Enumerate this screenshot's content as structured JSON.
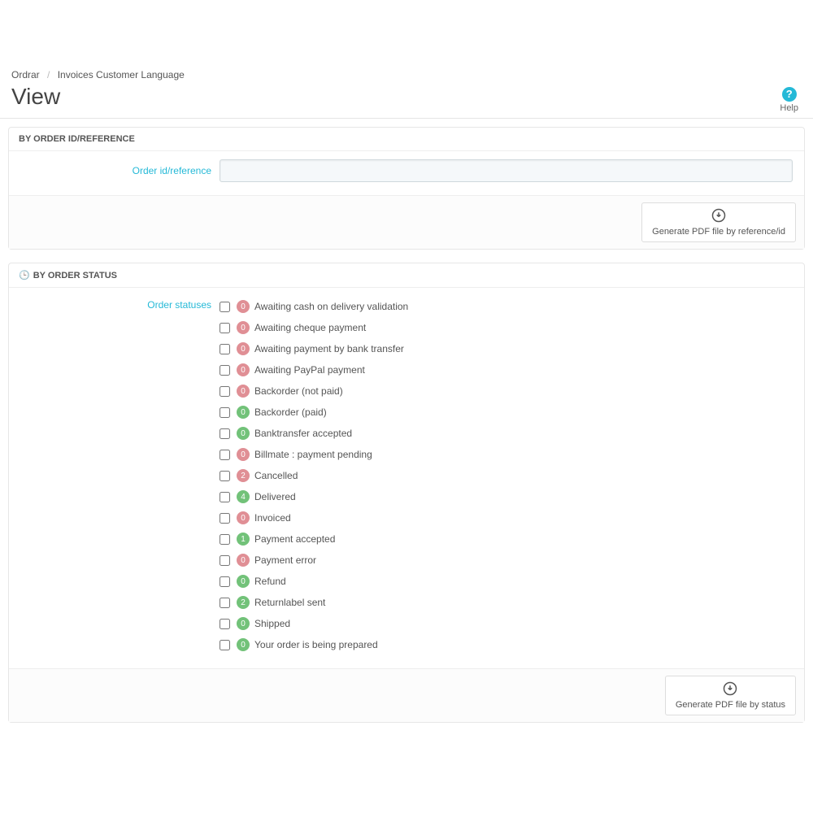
{
  "breadcrumb": {
    "root": "Ordrar",
    "current": "Invoices Customer Language"
  },
  "page_title": "View",
  "help": {
    "label": "Help"
  },
  "panel1": {
    "heading": "BY ORDER ID/REFERENCE",
    "label": "Order id/reference",
    "input_value": "",
    "button": "Generate PDF file by reference/id"
  },
  "panel2": {
    "heading": "BY ORDER STATUS",
    "label": "Order statuses",
    "button": "Generate PDF file by status",
    "statuses": [
      {
        "count": 0,
        "color": "red",
        "label": "Awaiting cash on delivery validation"
      },
      {
        "count": 0,
        "color": "red",
        "label": "Awaiting cheque payment"
      },
      {
        "count": 0,
        "color": "red",
        "label": "Awaiting payment by bank transfer"
      },
      {
        "count": 0,
        "color": "red",
        "label": "Awaiting PayPal payment"
      },
      {
        "count": 0,
        "color": "red",
        "label": "Backorder (not paid)"
      },
      {
        "count": 0,
        "color": "green",
        "label": "Backorder (paid)"
      },
      {
        "count": 0,
        "color": "green",
        "label": "Banktransfer accepted"
      },
      {
        "count": 0,
        "color": "red",
        "label": "Billmate : payment pending"
      },
      {
        "count": 2,
        "color": "red",
        "label": "Cancelled"
      },
      {
        "count": 4,
        "color": "green",
        "label": "Delivered"
      },
      {
        "count": 0,
        "color": "red",
        "label": "Invoiced"
      },
      {
        "count": 1,
        "color": "green",
        "label": "Payment accepted"
      },
      {
        "count": 0,
        "color": "red",
        "label": "Payment error"
      },
      {
        "count": 0,
        "color": "green",
        "label": "Refund"
      },
      {
        "count": 2,
        "color": "green",
        "label": "Returnlabel sent"
      },
      {
        "count": 0,
        "color": "green",
        "label": "Shipped"
      },
      {
        "count": 0,
        "color": "green",
        "label": "Your order is being prepared"
      }
    ]
  }
}
